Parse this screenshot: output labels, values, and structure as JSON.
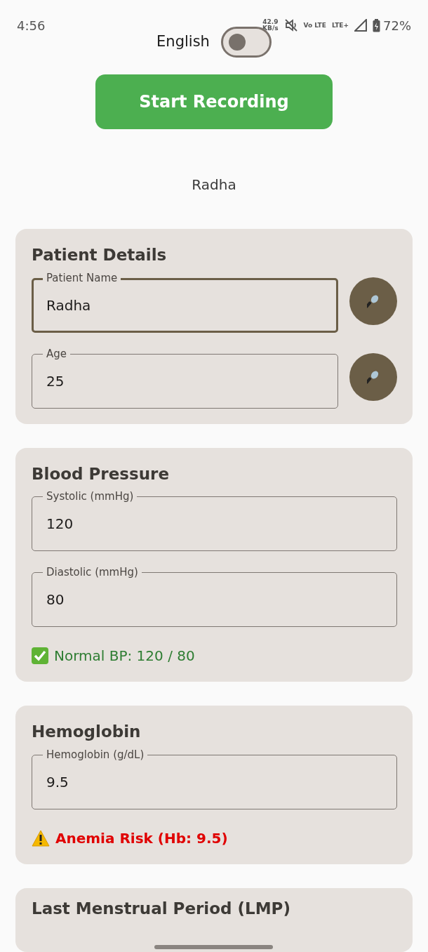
{
  "status_bar": {
    "time": "4:56",
    "speed": "42.9",
    "speed_unit": "KB/s",
    "volte": "Vo LTE",
    "network": "LTE+",
    "battery": "72%"
  },
  "language": {
    "label": "English",
    "on": false
  },
  "record_button": "Start Recording",
  "recognized_text": "Radha",
  "cards": [
    {
      "title": "Patient Details",
      "fields": [
        {
          "label": "Patient Name",
          "value": "Radha",
          "focused": true,
          "mic": true
        },
        {
          "label": "Age",
          "value": "25",
          "focused": false,
          "mic": true
        }
      ]
    },
    {
      "title": "Blood Pressure",
      "fields": [
        {
          "label": "Systolic (mmHg)",
          "value": "120",
          "focused": false,
          "mic": false
        },
        {
          "label": "Diastolic (mmHg)",
          "value": "80",
          "focused": false,
          "mic": false
        }
      ],
      "result": {
        "kind": "ok",
        "text": "Normal BP: 120 / 80"
      }
    },
    {
      "title": "Hemoglobin",
      "fields": [
        {
          "label": "Hemoglobin (g/dL)",
          "value": "9.5",
          "focused": false,
          "mic": false
        }
      ],
      "result": {
        "kind": "warn",
        "text": "Anemia Risk (Hb: 9.5)"
      }
    },
    {
      "title": "Last Menstrual Period (LMP)"
    }
  ]
}
